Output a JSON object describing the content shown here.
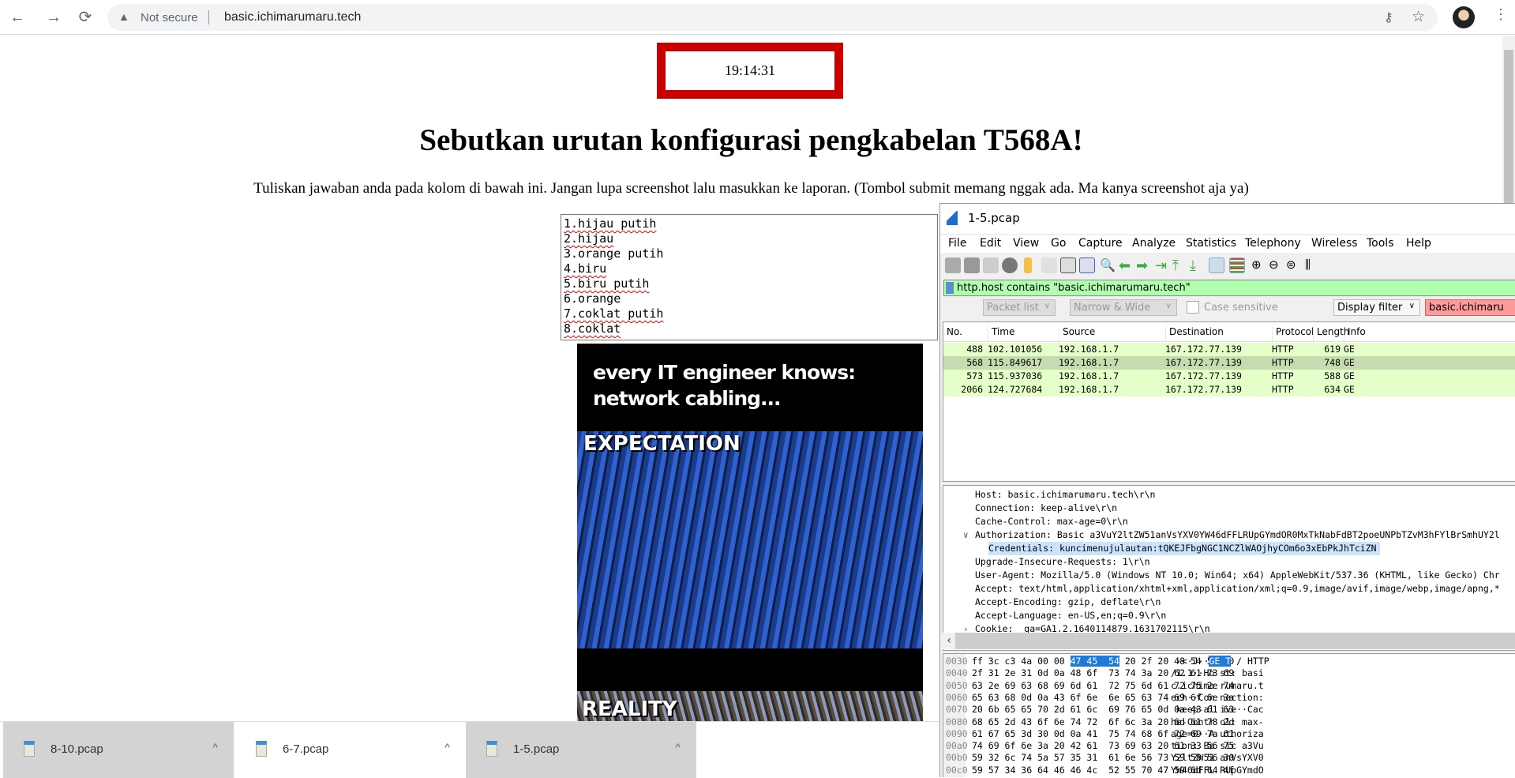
{
  "browser": {
    "url": "basic.ichimarumaru.tech",
    "security_label": "Not secure",
    "icons": [
      "back-icon",
      "forward-icon",
      "reload-icon",
      "warning-icon",
      "key-icon",
      "star-icon",
      "avatar",
      "menu-icon"
    ]
  },
  "page": {
    "timer": "19:14:31",
    "title": "Sebutkan urutan konfigurasi pengkabelan T568A!",
    "instructions": "Tuliskan jawaban anda pada kolom di bawah ini. Jangan lupa screenshot lalu masukkan ke laporan. (Tombol submit memang nggak ada. Ma kanya screenshot aja ya)",
    "answer_lines": [
      "1.hijau putih",
      "2.hijau",
      "3.orange putih",
      "4.biru",
      "5.biru putih",
      "6.orange",
      "7.coklat putih",
      "8.coklat"
    ],
    "meme": {
      "caption_line1": "every IT engineer knows:",
      "caption_line2": "network cabling...",
      "label1": "EXPECTATION",
      "label2": "REALITY"
    },
    "accent": "#c80000"
  },
  "downloads": [
    {
      "name": "8-10.pcap"
    },
    {
      "name": "6-7.pcap"
    },
    {
      "name": "1-5.pcap"
    }
  ],
  "wireshark": {
    "title": "1-5.pcap",
    "menu": [
      "File",
      "Edit",
      "View",
      "Go",
      "Capture",
      "Analyze",
      "Statistics",
      "Telephony",
      "Wireless",
      "Tools",
      "Help"
    ],
    "filter": "http.host contains \"basic.ichimarumaru.tech\"",
    "find": {
      "scope": "Packet list",
      "charset": "Narrow & Wide",
      "case_sensitive": "Case sensitive",
      "type": "Display filter",
      "value": "basic.ichimaru"
    },
    "columns": [
      "No.",
      "Time",
      "Source",
      "Destination",
      "Protocol",
      "Length",
      "Info"
    ],
    "packets": [
      {
        "no": "488",
        "time": "102.101056",
        "src": "192.168.1.7",
        "dst": "167.172.77.139",
        "proto": "HTTP",
        "len": "619",
        "info": "GE"
      },
      {
        "no": "568",
        "time": "115.849617",
        "src": "192.168.1.7",
        "dst": "167.172.77.139",
        "proto": "HTTP",
        "len": "748",
        "info": "GE"
      },
      {
        "no": "573",
        "time": "115.937036",
        "src": "192.168.1.7",
        "dst": "167.172.77.139",
        "proto": "HTTP",
        "len": "588",
        "info": "GE"
      },
      {
        "no": "2066",
        "time": "124.727684",
        "src": "192.168.1.7",
        "dst": "167.172.77.139",
        "proto": "HTTP",
        "len": "634",
        "info": "GE"
      }
    ],
    "details": [
      "Host: basic.ichimarumaru.tech\\r\\n",
      "Connection: keep-alive\\r\\n",
      "Cache-Control: max-age=0\\r\\n",
      "Authorization: Basic a3VuY2ltZW51anVsYXV0YW46dFFLRUpGYmdOR0MxTkNabFdBT2poeUNPbTZvM3hFYlBrSmhUY2l",
      "Credentials: kuncimenujulautan:tQKEJFbgNGC1NCZlWAOjhyCOm6o3xEbPkJhTciZN",
      "Upgrade-Insecure-Requests: 1\\r\\n",
      "User-Agent: Mozilla/5.0 (Windows NT 10.0; Win64; x64) AppleWebKit/537.36 (KHTML, like Gecko) Chr",
      "Accept: text/html,application/xhtml+xml,application/xml;q=0.9,image/avif,image/webp,image/apng,*",
      "Accept-Encoding: gzip, deflate\\r\\n",
      "Accept-Language: en-US,en;q=0.9\\r\\n",
      "Cookie: _ga=GA1.2.1640114879.1631702115\\r\\n"
    ],
    "hex": [
      {
        "o": "0030",
        "h": "ff 3c c3 4a 00 00 ",
        "hh": "47 45  54",
        "h2": " 20 2f 20 48 54 54 50",
        "a": " ·<·J··",
        "ah": "GE T",
        "a2": " / HTTP"
      },
      {
        "o": "0040",
        "h": "2f 31 2e 31 0d 0a 48 6f  73 74 3a 20 62 61 73 69",
        "a": "/1.1··Ho st: basi"
      },
      {
        "o": "0050",
        "h": "63 2e 69 63 68 69 6d 61  72 75 6d 61 72 75 2e 74",
        "a": "c.ichima rumaru.t"
      },
      {
        "o": "0060",
        "h": "65 63 68 0d 0a 43 6f 6e  6e 65 63 74 69 6f 6e 3a",
        "a": "ech··Con nection:"
      },
      {
        "o": "0070",
        "h": "20 6b 65 65 70 2d 61 6c  69 76 65 0d 0a 43 61 63",
        "a": " keep-al ive··Cac"
      },
      {
        "o": "0080",
        "h": "68 65 2d 43 6f 6e 74 72  6f 6c 3a 20 6d 61 78 2d",
        "a": "he-Contr ol: max-"
      },
      {
        "o": "0090",
        "h": "61 67 65 3d 30 0d 0a 41  75 74 68 6f 72 69 7a 61",
        "a": "age=0··A uthoriza"
      },
      {
        "o": "00a0",
        "h": "74 69 6f 6e 3a 20 42 61  73 69 63 20 61 33 56 75",
        "a": "tion: Ba sic a3Vu"
      },
      {
        "o": "00b0",
        "h": "59 32 6c 74 5a 57 35 31  61 6e 56 73 59 58 56 30",
        "a": "Y2ltZW51 anVsYXV0"
      },
      {
        "o": "00c0",
        "h": "59 57 34 36 64 46 46 4c  52 55 70 47 59 6d 64 4f",
        "a": "YW46dFFL RUpGYmdO"
      }
    ],
    "colors": {
      "filter_ok": "#afffaf",
      "find_bad": "#ff9a9a",
      "packet_row": "#e4ffc7",
      "selected_row": "#c6dcb0",
      "highlight": "#1f7ad8"
    }
  }
}
